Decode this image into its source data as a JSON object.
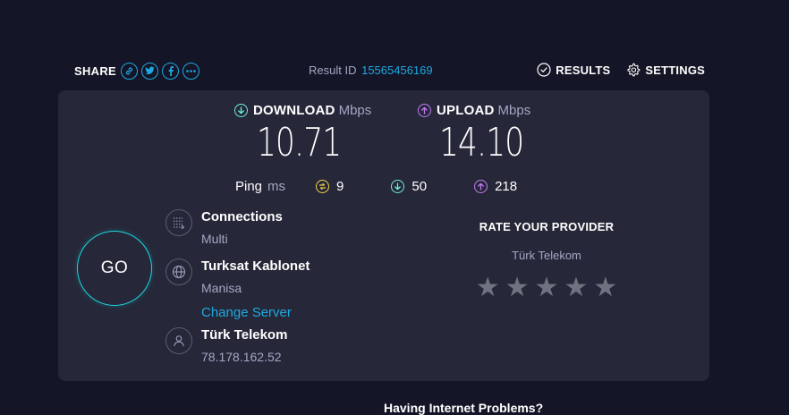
{
  "share": {
    "label": "SHARE",
    "icons": [
      "link-icon",
      "twitter-icon",
      "facebook-icon",
      "more-icon"
    ]
  },
  "result": {
    "label": "Result ID",
    "id": "15565456169"
  },
  "nav": {
    "results_label": "RESULTS",
    "settings_label": "SETTINGS"
  },
  "download": {
    "label": "DOWNLOAD",
    "unit": "Mbps",
    "value": "10.71",
    "icon": "download-arrow-icon",
    "color": "#6ff0da"
  },
  "upload": {
    "label": "UPLOAD",
    "unit": "Mbps",
    "value": "14.10",
    "icon": "upload-arrow-icon",
    "color": "#c37bf6"
  },
  "ping": {
    "label": "Ping",
    "unit": "ms",
    "idle": "9",
    "download": "50",
    "upload": "218",
    "idle_color": "#f5d34a"
  },
  "go_label": "GO",
  "connections": {
    "title": "Connections",
    "value": "Multi",
    "icon": "connections-icon"
  },
  "server": {
    "title": "Turksat Kablonet",
    "location": "Manisa",
    "change_label": "Change Server",
    "icon": "globe-icon"
  },
  "provider": {
    "title": "Türk Telekom",
    "ip": "78.178.162.52",
    "icon": "user-icon"
  },
  "rate": {
    "title": "RATE YOUR PROVIDER",
    "provider": "Türk Telekom",
    "stars": 5,
    "rating": 0
  },
  "bottom": {
    "text": "Having Internet Problems?"
  },
  "colors": {
    "background": "#141526",
    "panel": "#262839",
    "accent": "#1ea8e0",
    "go_ring": "#1dd6e0"
  }
}
